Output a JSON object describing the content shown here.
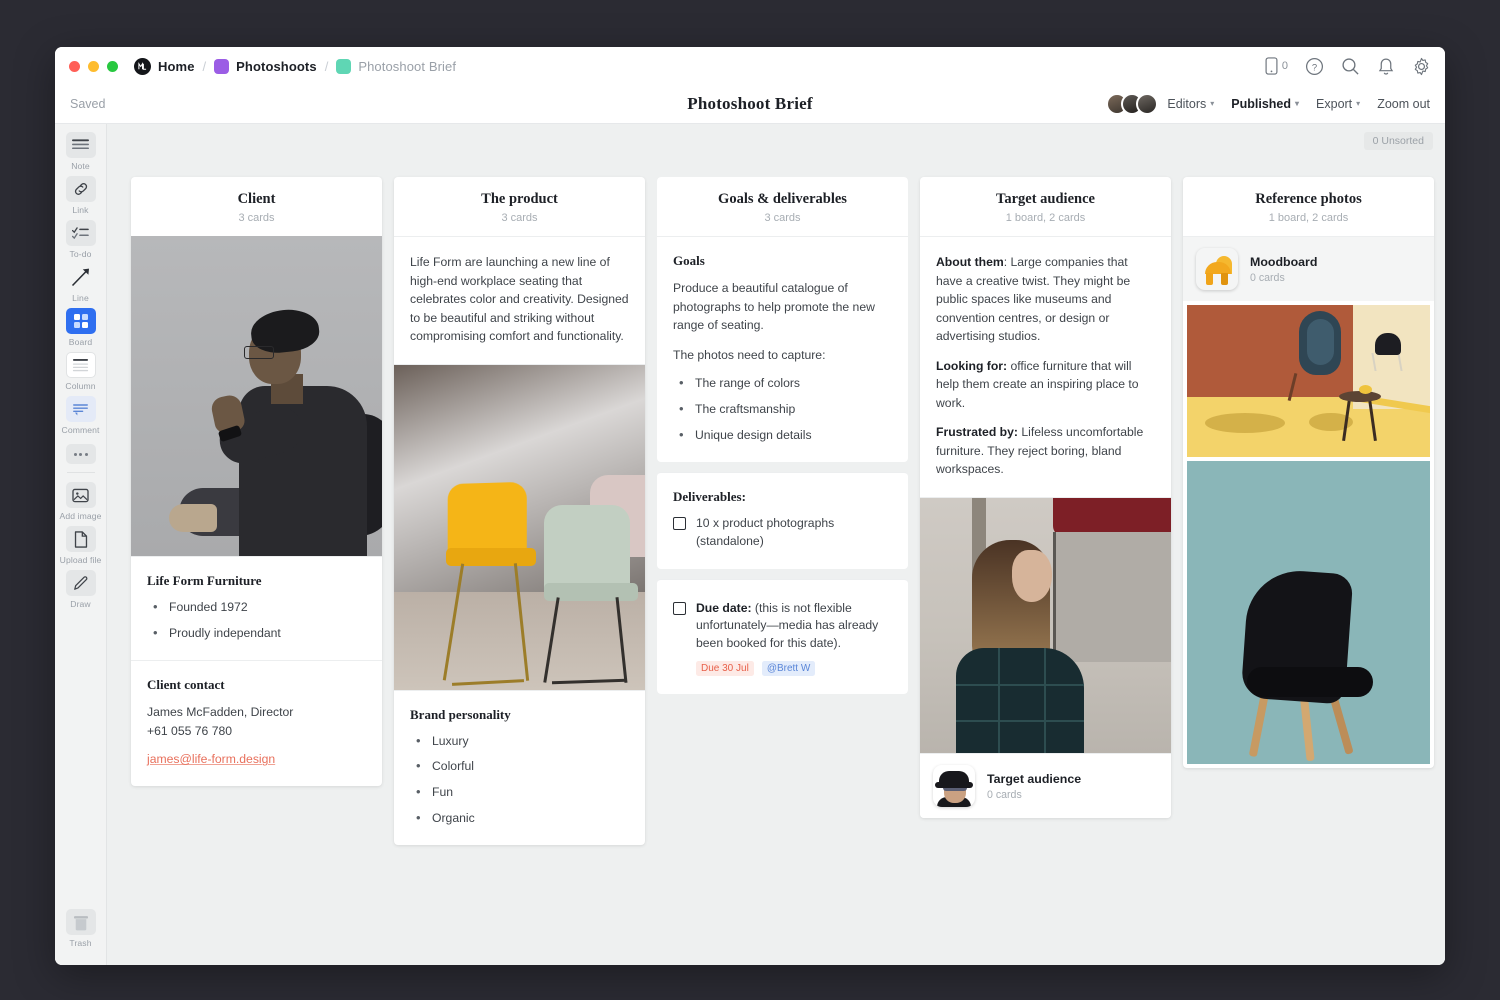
{
  "titlebar": {
    "breadcrumbs": [
      {
        "label": "Home",
        "icon": "milanote-logo-icon",
        "color": "#14161a",
        "muted": false
      },
      {
        "label": "Photoshoots",
        "icon": "board-swatch-icon",
        "color": "#9b5de5",
        "muted": false
      },
      {
        "label": "Photoshoot Brief",
        "icon": "board-swatch-icon",
        "color": "#5fd6b4",
        "muted": true
      }
    ],
    "separator": "/",
    "icons": [
      {
        "name": "mobile-icon",
        "count": "0"
      },
      {
        "name": "help-icon"
      },
      {
        "name": "search-icon"
      },
      {
        "name": "notifications-icon"
      },
      {
        "name": "settings-icon"
      }
    ]
  },
  "header": {
    "saved_label": "Saved",
    "title": "Photoshoot Brief",
    "editors_label": "Editors",
    "published_label": "Published",
    "export_label": "Export",
    "zoom_label": "Zoom out",
    "caret": "▾"
  },
  "toolbar": {
    "items": [
      {
        "label": "Note",
        "icon": "note-icon"
      },
      {
        "label": "Link",
        "icon": "link-icon"
      },
      {
        "label": "To-do",
        "icon": "todo-icon"
      },
      {
        "label": "Line",
        "icon": "line-arrow-icon"
      },
      {
        "label": "Board",
        "icon": "board-icon"
      },
      {
        "label": "Column",
        "icon": "column-icon"
      },
      {
        "label": "Comment",
        "icon": "comment-icon"
      }
    ],
    "more_label": "more-options",
    "file_items": [
      {
        "label": "Add image",
        "icon": "image-icon"
      },
      {
        "label": "Upload file",
        "icon": "file-icon"
      },
      {
        "label": "Draw",
        "icon": "pencil-icon"
      }
    ],
    "trash_label": "Trash"
  },
  "canvas": {
    "unsorted_badge": "0 Unsorted"
  },
  "columns": [
    {
      "title": "Client",
      "subtitle": "3 cards",
      "photo": "man-sitting-on-chair-photo",
      "cards": [
        {
          "heading": "Life Form Furniture",
          "bullets": [
            "Founded 1972",
            "Proudly independant"
          ]
        },
        {
          "heading": "Client contact",
          "lines": [
            "James McFadden, Director",
            "+61 055 76 780"
          ],
          "email": "james@life-form.design"
        }
      ]
    },
    {
      "title": "The product",
      "subtitle": "3 cards",
      "intro": "Life Form are launching a new line of high-end workplace seating that celebrates color and creativity. Designed to be beautiful and striking without compromising comfort and functionality.",
      "photo": "yellow-and-green-chairs-photo",
      "cards": [
        {
          "heading": "Brand personality",
          "bullets": [
            "Luxury",
            "Colorful",
            "Fun",
            "Organic"
          ]
        }
      ]
    },
    {
      "title": "Goals & deliverables",
      "subtitle": "3 cards",
      "goals": {
        "heading": "Goals",
        "para1": "Produce a beautiful catalogue of photographs to help promote the new range of seating.",
        "para2": "The photos need to capture:",
        "bullets": [
          "The range of colors",
          "The craftsmanship",
          "Unique design details"
        ]
      },
      "deliverables": {
        "heading": "Deliverables:",
        "item": "10 x product photographs (standalone)"
      },
      "duedate": {
        "label": "Due date:",
        "text": " (this is not flexible unfortunately—media has already been booked for this date).",
        "due_tag": "Due 30 Jul",
        "mention_tag": "@Brett W"
      }
    },
    {
      "title": "Target audience",
      "subtitle": "1 board, 2 cards",
      "about_label": "About them",
      "about_text": ": Large companies that have a creative twist. They might be public spaces like museums and convention centres, or design or advertising studios.",
      "looking_label": "Looking for:",
      "looking_text": " office furniture that will help them create an inspiring place to work.",
      "frustrated_label": "Frustrated by:",
      "frustrated_text": " Lifeless uncomfortable furniture. They reject boring, bland workspaces.",
      "photo": "woman-on-street-photo",
      "board": {
        "name": "Target audience",
        "sub": "0 cards",
        "thumb": "person-with-hat-thumbnail"
      }
    },
    {
      "title": "Reference photos",
      "subtitle": "1 board, 2 cards",
      "board": {
        "name": "Moodboard",
        "sub": "0 cards",
        "thumb": "yellow-chair-thumbnail"
      },
      "photos": [
        "orange-yellow-room-chairs-photo",
        "black-chair-on-teal-photo"
      ]
    }
  ],
  "colors": {
    "accent": "#2f6ff0",
    "due_tag_bg": "#fdeae6",
    "due_tag_fg": "#e8604a",
    "mention_bg": "#e3ecfb",
    "mention_fg": "#5a86d8",
    "email_link": "#e8705c",
    "canvas_bg": "#eef0f0"
  }
}
